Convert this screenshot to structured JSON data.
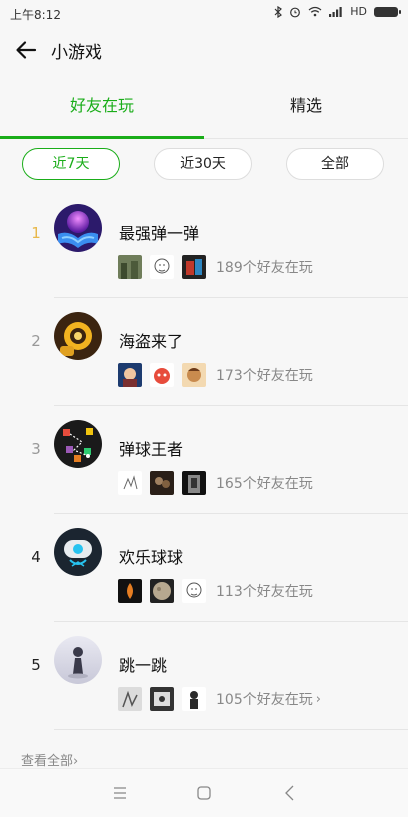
{
  "status_bar": {
    "time": "上午8:12",
    "network": "HD"
  },
  "header": {
    "title": "小游戏",
    "back_icon": "arrow-left-icon"
  },
  "tabs": [
    {
      "label": "好友在玩",
      "active": true
    },
    {
      "label": "精选",
      "active": false
    }
  ],
  "filters": [
    {
      "label": "近7天",
      "active": true
    },
    {
      "label": "近30天",
      "active": false
    },
    {
      "label": "全部",
      "active": false
    }
  ],
  "games": [
    {
      "rank": "1",
      "name": "最强弹一弹",
      "friends_text": "189个好友在玩"
    },
    {
      "rank": "2",
      "name": "海盗来了",
      "friends_text": "173个好友在玩"
    },
    {
      "rank": "3",
      "name": "弹球王者",
      "friends_text": "165个好友在玩"
    },
    {
      "rank": "4",
      "name": "欢乐球球",
      "friends_text": "113个好友在玩"
    },
    {
      "rank": "5",
      "name": "跳一跳",
      "friends_text": "105个好友在玩"
    }
  ],
  "view_all": "查看全部",
  "colors": {
    "accent": "#1aad19",
    "rank_top": "#e8b84a"
  }
}
